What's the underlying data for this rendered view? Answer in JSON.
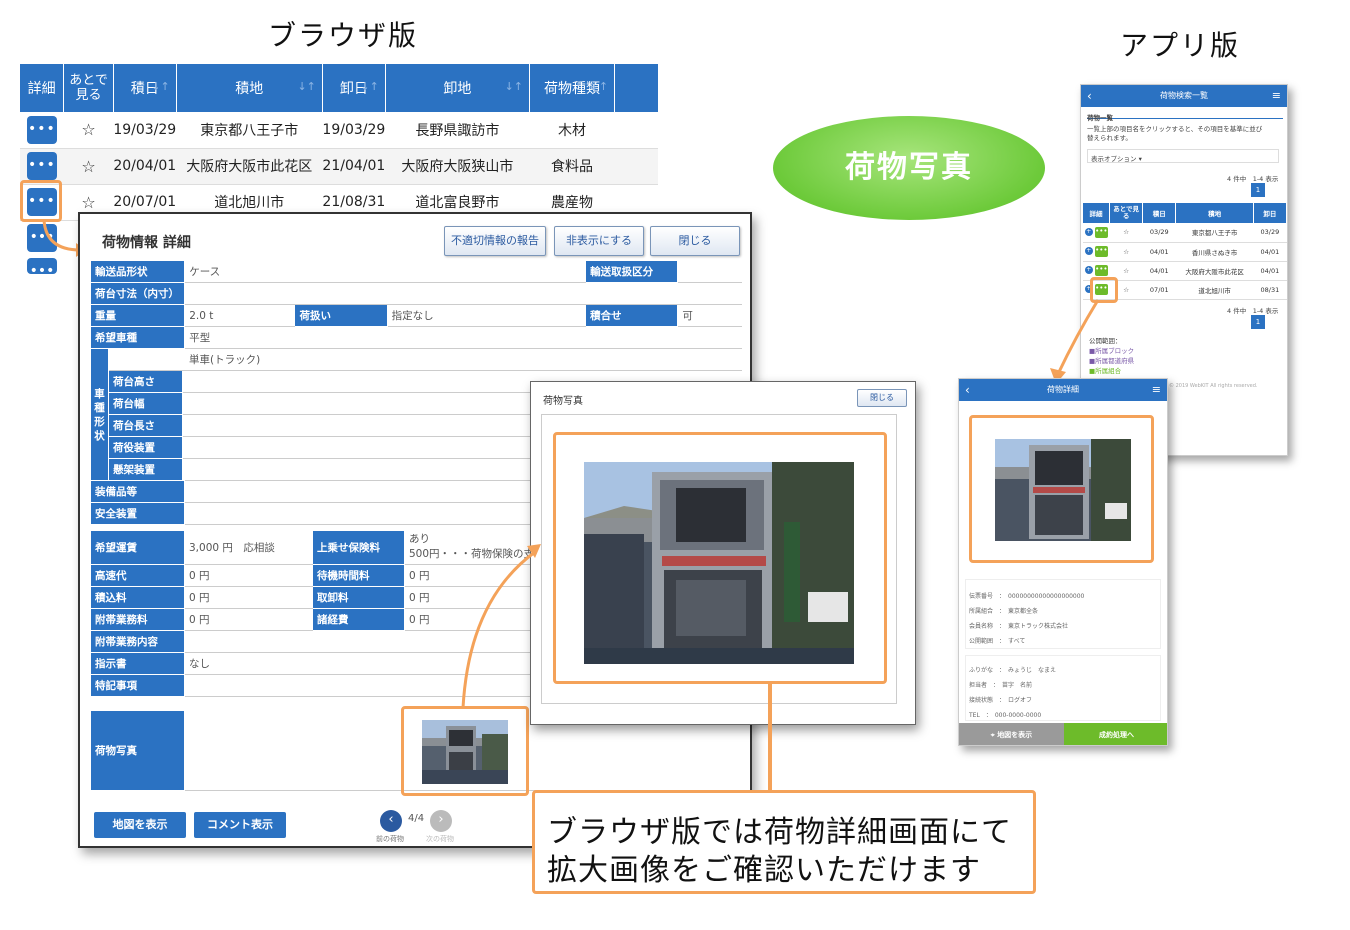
{
  "headings": {
    "browser": "ブラウザ版",
    "app": "アプリ版"
  },
  "badge": "荷物写真",
  "callout": {
    "line1": "ブラウザ版では荷物詳細画面にて",
    "line2": "拡大画像をご確認いただけます"
  },
  "list": {
    "headers": [
      "詳細",
      "あとで\n見る",
      "積日",
      "積地",
      "卸日",
      "卸地",
      "荷物種類"
    ],
    "rows": [
      [
        "19/03/29",
        "東京都八王子市",
        "19/03/29",
        "長野県諏訪市",
        "木材"
      ],
      [
        "20/04/01",
        "大阪府大阪市此花区",
        "21/04/01",
        "大阪府大阪狭山市",
        "食料品"
      ],
      [
        "20/07/01",
        "道北旭川市",
        "21/08/31",
        "道北富良野市",
        "農産物"
      ]
    ],
    "more_label": "•••"
  },
  "detail": {
    "title": "荷物情報 詳細",
    "buttons": {
      "report": "不適切情報の報告",
      "hide": "非表示にする",
      "close": "閉じる"
    },
    "rows": {
      "shape": {
        "label": "輸送品形状",
        "value": "ケース"
      },
      "class": {
        "label": "輸送取扱区分"
      },
      "size": {
        "label": "荷台寸法（内寸）"
      },
      "weight": {
        "label": "重量",
        "value": "2.0 t"
      },
      "handling": {
        "label": "荷扱い",
        "value": "指定なし"
      },
      "combine": {
        "label": "積合せ",
        "value": "可"
      },
      "vehicle_type": {
        "label": "希望車種",
        "value": "平型"
      },
      "vehicle_shape": {
        "label": "車種形状",
        "value": "単車(トラック)"
      },
      "sub": [
        "荷台高さ",
        "荷台幅",
        "荷台長さ",
        "荷役装置",
        "懸架装置"
      ],
      "equipment": {
        "label": "装備品等"
      },
      "safety": {
        "label": "安全装置"
      },
      "fare": {
        "label": "希望運賃",
        "value": "3,000 円　応相談"
      },
      "insurance": {
        "label": "上乗せ保険料",
        "value1": "あり",
        "value2": "500円・・・荷物保険の支"
      },
      "highway": {
        "label": "高速代",
        "value": "0 円"
      },
      "wait": {
        "label": "待機時間料",
        "value": "0 円"
      },
      "loading": {
        "label": "積込料",
        "value": "0 円"
      },
      "unloading": {
        "label": "取卸料",
        "value": "0 円"
      },
      "incidental": {
        "label": "附帯業務料",
        "value": "0 円"
      },
      "misc": {
        "label": "諸経費",
        "value": "0 円"
      },
      "incidental_detail": {
        "label": "附帯業務内容"
      },
      "instruction": {
        "label": "指示書",
        "value": "なし"
      },
      "notes": {
        "label": "特記事項"
      },
      "photo": {
        "label": "荷物写真"
      }
    },
    "footer": {
      "map": "地図を表示",
      "comment": "コメント表示",
      "page": "4/4",
      "prev": "前の荷物",
      "next": "次の荷物"
    }
  },
  "modal": {
    "title": "荷物写真",
    "close": "閉じる"
  },
  "app1": {
    "title": "荷物検索一覧",
    "section": "荷物一覧",
    "desc1": "一覧上部の項目名をクリックすると、その項目を基準に並び",
    "desc2": "替えられます。",
    "option": "表示オプション ▾",
    "count": "4 件中　1-4 表示",
    "page": "1",
    "headers": [
      "詳細",
      "あとで見る",
      "積日",
      "積地",
      "卸日"
    ],
    "rows": [
      [
        "03/29",
        "東京都八王子市",
        "03/29"
      ],
      [
        "04/01",
        "香川県さぬき市",
        "04/01"
      ],
      [
        "04/01",
        "大阪府大阪市此花区",
        "04/01"
      ],
      [
        "07/01",
        "道北旭川市",
        "08/31"
      ]
    ],
    "scope_title": "公開範囲：",
    "scope": [
      "所属ブロック",
      "所属都道府県",
      "所属組合"
    ],
    "copyright": "© 2019 WebKIT All rights reserved."
  },
  "app2": {
    "title": "荷物詳細",
    "fields": [
      [
        "伝票番号",
        "00000000000000000000"
      ],
      [
        "所属組合",
        "東京都全条"
      ],
      [
        "会員名称",
        "東京トラック株式会社"
      ],
      [
        "公開範囲",
        "すべて"
      ]
    ],
    "fields2": [
      [
        "ふりがな",
        "みょうじ　なまえ"
      ],
      [
        "担当者",
        "苗字　名前"
      ],
      [
        "接続状態",
        "ログオフ"
      ],
      [
        "TEL",
        "000-0000-0000"
      ]
    ],
    "map": "地図を表示",
    "contract": "成約処理へ"
  },
  "colors": {
    "accent": "#2b72c2",
    "highlight": "#f4a259",
    "green": "#6dbb2a"
  }
}
